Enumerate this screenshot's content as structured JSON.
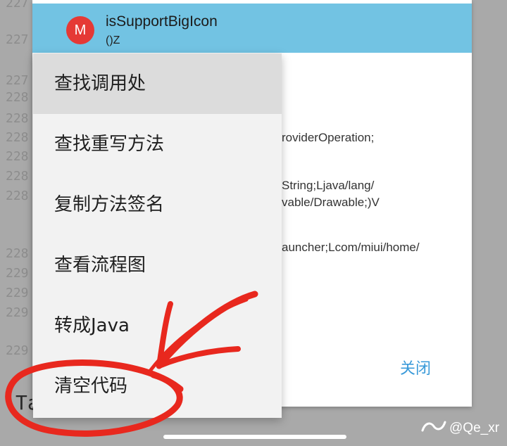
{
  "background": {
    "line_numbers": [
      "227",
      "227",
      "227",
      "228",
      "228",
      "228",
      "228",
      "228",
      "228",
      "228",
      "229",
      "229",
      "229",
      "229"
    ],
    "bottom_partial": "Ta"
  },
  "dialog": {
    "avatar_letter": "M",
    "title": "isSupportBigIcon",
    "subtitle": "()Z",
    "code_lines": [
      "roviderOperation;",
      "String;Ljava/lang/",
      "vable/Drawable;)V",
      "auncher;Lcom/miui/home/"
    ],
    "close_label": "关闭"
  },
  "context_menu": {
    "items": [
      {
        "label": "查找调用处"
      },
      {
        "label": "查找重写方法"
      },
      {
        "label": "复制方法签名"
      },
      {
        "label": "查看流程图"
      },
      {
        "label": "转成Java"
      },
      {
        "label": "清空代码"
      }
    ],
    "active_index": 0
  },
  "watermark": {
    "text": "@Qe_xr"
  },
  "colors": {
    "header": "#72c3e3",
    "avatar": "#e53935",
    "close_button": "#3a9ad9",
    "annotation": "#e8281e"
  },
  "icons": {
    "watermark": "platform-logo-icon"
  }
}
